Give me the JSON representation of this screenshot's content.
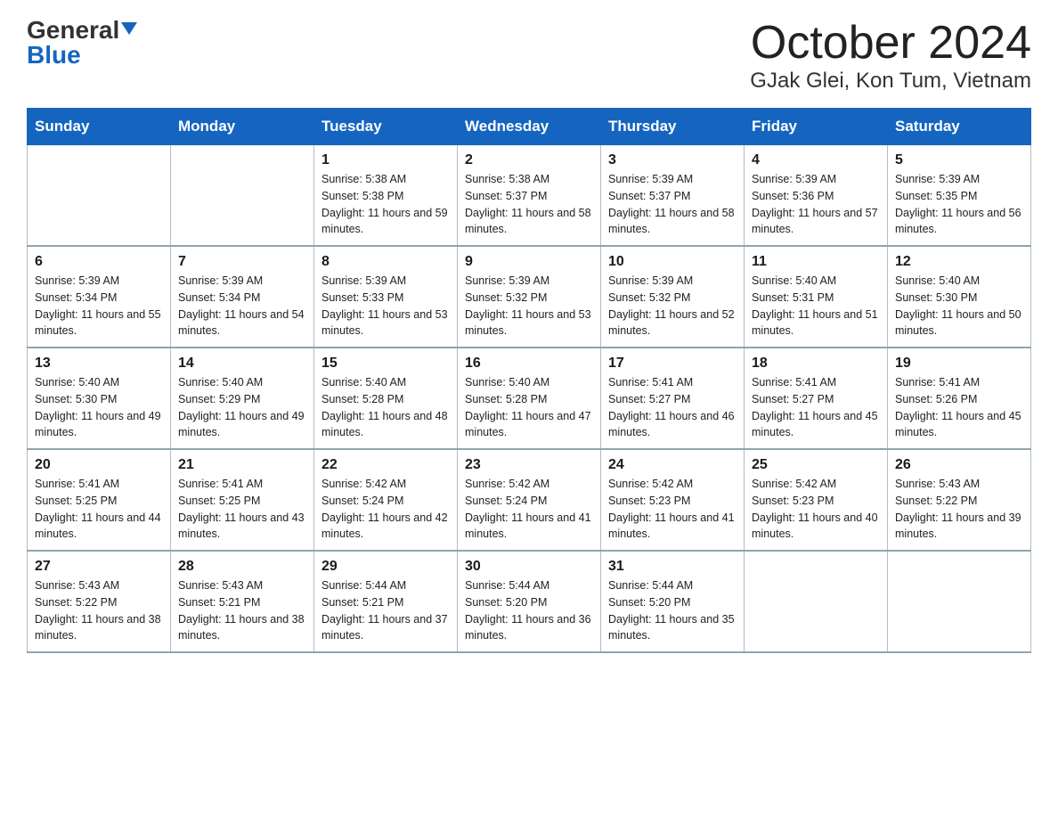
{
  "header": {
    "logo_general": "General",
    "logo_blue": "Blue",
    "month_title": "October 2024",
    "location": "GJak Glei, Kon Tum, Vietnam"
  },
  "days_of_week": [
    "Sunday",
    "Monday",
    "Tuesday",
    "Wednesday",
    "Thursday",
    "Friday",
    "Saturday"
  ],
  "weeks": [
    [
      {
        "day": "",
        "sunrise": "",
        "sunset": "",
        "daylight": ""
      },
      {
        "day": "",
        "sunrise": "",
        "sunset": "",
        "daylight": ""
      },
      {
        "day": "1",
        "sunrise": "Sunrise: 5:38 AM",
        "sunset": "Sunset: 5:38 PM",
        "daylight": "Daylight: 11 hours and 59 minutes."
      },
      {
        "day": "2",
        "sunrise": "Sunrise: 5:38 AM",
        "sunset": "Sunset: 5:37 PM",
        "daylight": "Daylight: 11 hours and 58 minutes."
      },
      {
        "day": "3",
        "sunrise": "Sunrise: 5:39 AM",
        "sunset": "Sunset: 5:37 PM",
        "daylight": "Daylight: 11 hours and 58 minutes."
      },
      {
        "day": "4",
        "sunrise": "Sunrise: 5:39 AM",
        "sunset": "Sunset: 5:36 PM",
        "daylight": "Daylight: 11 hours and 57 minutes."
      },
      {
        "day": "5",
        "sunrise": "Sunrise: 5:39 AM",
        "sunset": "Sunset: 5:35 PM",
        "daylight": "Daylight: 11 hours and 56 minutes."
      }
    ],
    [
      {
        "day": "6",
        "sunrise": "Sunrise: 5:39 AM",
        "sunset": "Sunset: 5:34 PM",
        "daylight": "Daylight: 11 hours and 55 minutes."
      },
      {
        "day": "7",
        "sunrise": "Sunrise: 5:39 AM",
        "sunset": "Sunset: 5:34 PM",
        "daylight": "Daylight: 11 hours and 54 minutes."
      },
      {
        "day": "8",
        "sunrise": "Sunrise: 5:39 AM",
        "sunset": "Sunset: 5:33 PM",
        "daylight": "Daylight: 11 hours and 53 minutes."
      },
      {
        "day": "9",
        "sunrise": "Sunrise: 5:39 AM",
        "sunset": "Sunset: 5:32 PM",
        "daylight": "Daylight: 11 hours and 53 minutes."
      },
      {
        "day": "10",
        "sunrise": "Sunrise: 5:39 AM",
        "sunset": "Sunset: 5:32 PM",
        "daylight": "Daylight: 11 hours and 52 minutes."
      },
      {
        "day": "11",
        "sunrise": "Sunrise: 5:40 AM",
        "sunset": "Sunset: 5:31 PM",
        "daylight": "Daylight: 11 hours and 51 minutes."
      },
      {
        "day": "12",
        "sunrise": "Sunrise: 5:40 AM",
        "sunset": "Sunset: 5:30 PM",
        "daylight": "Daylight: 11 hours and 50 minutes."
      }
    ],
    [
      {
        "day": "13",
        "sunrise": "Sunrise: 5:40 AM",
        "sunset": "Sunset: 5:30 PM",
        "daylight": "Daylight: 11 hours and 49 minutes."
      },
      {
        "day": "14",
        "sunrise": "Sunrise: 5:40 AM",
        "sunset": "Sunset: 5:29 PM",
        "daylight": "Daylight: 11 hours and 49 minutes."
      },
      {
        "day": "15",
        "sunrise": "Sunrise: 5:40 AM",
        "sunset": "Sunset: 5:28 PM",
        "daylight": "Daylight: 11 hours and 48 minutes."
      },
      {
        "day": "16",
        "sunrise": "Sunrise: 5:40 AM",
        "sunset": "Sunset: 5:28 PM",
        "daylight": "Daylight: 11 hours and 47 minutes."
      },
      {
        "day": "17",
        "sunrise": "Sunrise: 5:41 AM",
        "sunset": "Sunset: 5:27 PM",
        "daylight": "Daylight: 11 hours and 46 minutes."
      },
      {
        "day": "18",
        "sunrise": "Sunrise: 5:41 AM",
        "sunset": "Sunset: 5:27 PM",
        "daylight": "Daylight: 11 hours and 45 minutes."
      },
      {
        "day": "19",
        "sunrise": "Sunrise: 5:41 AM",
        "sunset": "Sunset: 5:26 PM",
        "daylight": "Daylight: 11 hours and 45 minutes."
      }
    ],
    [
      {
        "day": "20",
        "sunrise": "Sunrise: 5:41 AM",
        "sunset": "Sunset: 5:25 PM",
        "daylight": "Daylight: 11 hours and 44 minutes."
      },
      {
        "day": "21",
        "sunrise": "Sunrise: 5:41 AM",
        "sunset": "Sunset: 5:25 PM",
        "daylight": "Daylight: 11 hours and 43 minutes."
      },
      {
        "day": "22",
        "sunrise": "Sunrise: 5:42 AM",
        "sunset": "Sunset: 5:24 PM",
        "daylight": "Daylight: 11 hours and 42 minutes."
      },
      {
        "day": "23",
        "sunrise": "Sunrise: 5:42 AM",
        "sunset": "Sunset: 5:24 PM",
        "daylight": "Daylight: 11 hours and 41 minutes."
      },
      {
        "day": "24",
        "sunrise": "Sunrise: 5:42 AM",
        "sunset": "Sunset: 5:23 PM",
        "daylight": "Daylight: 11 hours and 41 minutes."
      },
      {
        "day": "25",
        "sunrise": "Sunrise: 5:42 AM",
        "sunset": "Sunset: 5:23 PM",
        "daylight": "Daylight: 11 hours and 40 minutes."
      },
      {
        "day": "26",
        "sunrise": "Sunrise: 5:43 AM",
        "sunset": "Sunset: 5:22 PM",
        "daylight": "Daylight: 11 hours and 39 minutes."
      }
    ],
    [
      {
        "day": "27",
        "sunrise": "Sunrise: 5:43 AM",
        "sunset": "Sunset: 5:22 PM",
        "daylight": "Daylight: 11 hours and 38 minutes."
      },
      {
        "day": "28",
        "sunrise": "Sunrise: 5:43 AM",
        "sunset": "Sunset: 5:21 PM",
        "daylight": "Daylight: 11 hours and 38 minutes."
      },
      {
        "day": "29",
        "sunrise": "Sunrise: 5:44 AM",
        "sunset": "Sunset: 5:21 PM",
        "daylight": "Daylight: 11 hours and 37 minutes."
      },
      {
        "day": "30",
        "sunrise": "Sunrise: 5:44 AM",
        "sunset": "Sunset: 5:20 PM",
        "daylight": "Daylight: 11 hours and 36 minutes."
      },
      {
        "day": "31",
        "sunrise": "Sunrise: 5:44 AM",
        "sunset": "Sunset: 5:20 PM",
        "daylight": "Daylight: 11 hours and 35 minutes."
      },
      {
        "day": "",
        "sunrise": "",
        "sunset": "",
        "daylight": ""
      },
      {
        "day": "",
        "sunrise": "",
        "sunset": "",
        "daylight": ""
      }
    ]
  ]
}
